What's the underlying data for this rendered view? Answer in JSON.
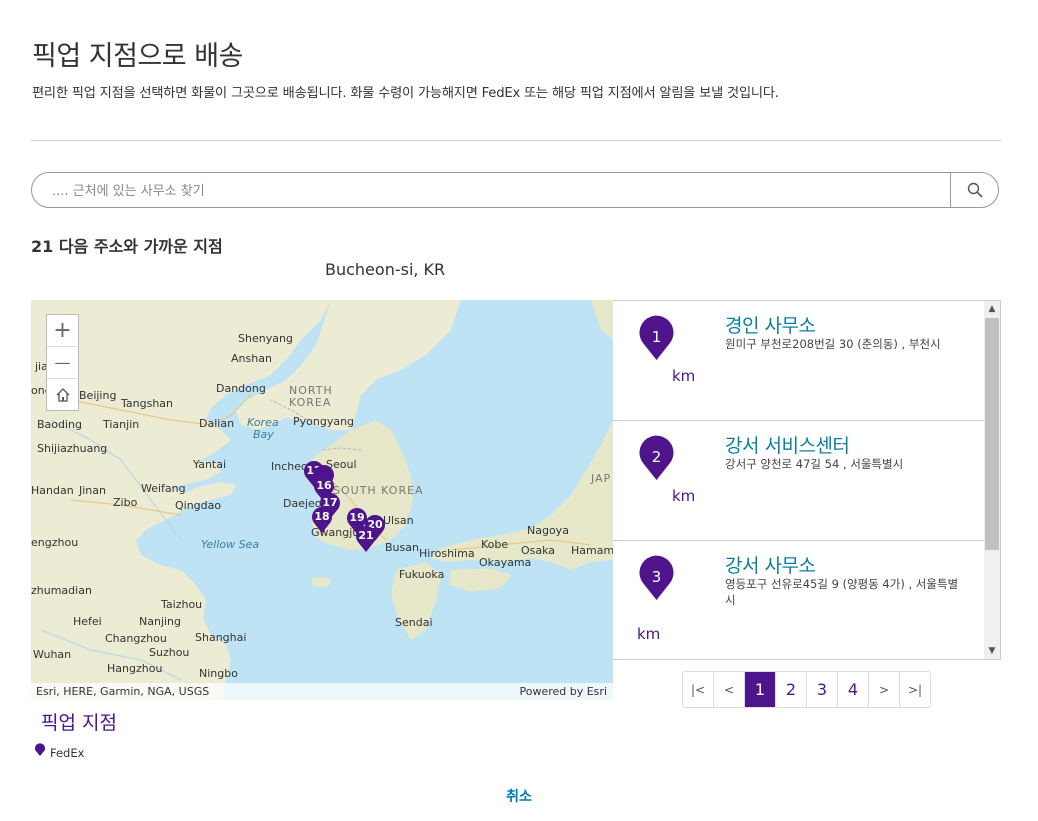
{
  "header": {
    "title": "픽업 지점으로 배송",
    "subtitle": "편리한 픽업 지점을 선택하면 화물이 그곳으로 배송됩니다. 화물 수령이 가능해지면 FedEx 또는 해당 픽업 지점에서 알림을 보낼 것입니다."
  },
  "search": {
    "placeholder": ".... 근처에 있는 사무소 찾기",
    "value": "",
    "icon": "search-icon"
  },
  "results": {
    "heading": "21 다음 주소와 가까운 지점",
    "address": "Bucheon-si, KR"
  },
  "map": {
    "attribution_left": "Esri, HERE, Garmin, NGA, USGS",
    "attribution_right": "Powered by Esri",
    "zoom_in": "+",
    "zoom_out": "—",
    "home_icon": "home-icon",
    "labels": {
      "shenyang": "Shenyang",
      "anshan": "Anshan",
      "tangshan_west": "jiakou",
      "dandong": "Dandong",
      "north_korea_1": "NORTH",
      "north_korea_2": "KOREA",
      "beijing": "Beijing",
      "tangshan": "Tangshan",
      "korea_bay_1": "Korea",
      "korea_bay_2": "Bay",
      "baoding": "Baoding",
      "tianjin": "Tianjin",
      "dalian": "Dalian",
      "pyongyang": "Pyongyang",
      "shijiazhuang": "Shijiazhuang",
      "yantai": "Yantai",
      "incheon": "Incheon",
      "seoul": "Seoul",
      "handan": "Handan",
      "jinan": "Jinan",
      "weifang": "Weifang",
      "south_korea": "SOUTH KOREA",
      "zibo": "Zibo",
      "qingdao": "Qingdao",
      "daejeon": "Daejeon",
      "ulsan": "Ulsan",
      "gwangju": "Gwangju",
      "busan": "Busan",
      "zhengzhou": "engzhou",
      "yellow_sea": "Yellow Sea",
      "nagoya": "Nagoya",
      "japan": "JAP",
      "kobe": "Kobe",
      "hiroshima": "Hiroshima",
      "osaka": "Osaka",
      "hamamatsu": "Hamama",
      "okayama": "Okayama",
      "fukuoka": "Fukuoka",
      "zhumadian": "zhumadian",
      "taizhou": "Taizhou",
      "hefei": "Hefei",
      "nanjing": "Nanjing",
      "sendai": "Sendai",
      "changzhou": "Changzhou",
      "shanghai": "Shanghai",
      "wuhan": "Wuhan",
      "suzhou": "Suzhou",
      "hangzhou": "Hangzhou",
      "ningbo": "Ningbo",
      "ngdong": "ong"
    },
    "pins": [
      "12",
      "16",
      "17",
      "18",
      "19",
      "20",
      "21"
    ]
  },
  "locations": [
    {
      "number": "1",
      "name": "경인 사무소",
      "address": "원미구 부천로208번길 30 (춘의동) , 부천시",
      "distance_unit": "km"
    },
    {
      "number": "2",
      "name": "강서 서비스센터",
      "address": "강서구 양천로 47길 54 , 서울특별시",
      "distance_unit": "km"
    },
    {
      "number": "3",
      "name": "강서 사무소",
      "address": "영등포구 선유로45길 9 (양평동 4가) , 서울특별시",
      "distance_unit": "km"
    }
  ],
  "pagination": {
    "first": "|<",
    "prev": "<",
    "pages": [
      "1",
      "2",
      "3",
      "4"
    ],
    "current": "1",
    "next": ">",
    "last": ">|"
  },
  "legend": {
    "title": "픽업 지점",
    "item": "FedEx"
  },
  "footer": {
    "cancel": "취소"
  },
  "colors": {
    "brand_purple": "#4d148c",
    "link_blue": "#0a7fa6",
    "cancel_blue": "#007ab7"
  }
}
